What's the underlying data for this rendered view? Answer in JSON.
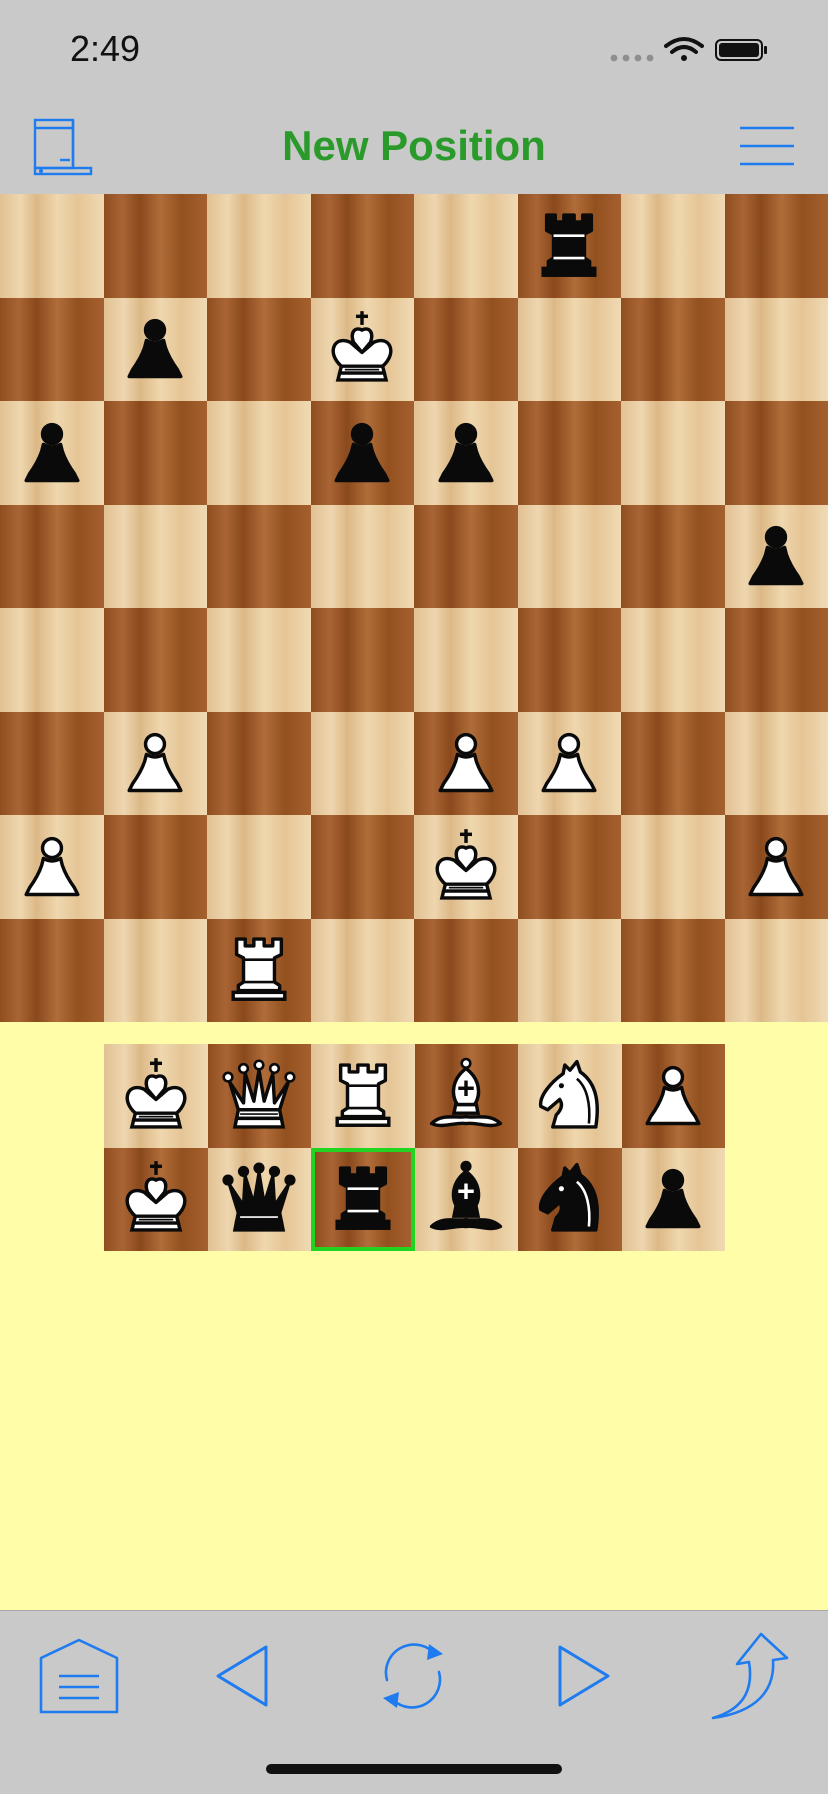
{
  "status_bar": {
    "time": "2:49"
  },
  "nav": {
    "title": "New Position",
    "title_color": "#2a9a2a"
  },
  "colors": {
    "accent": "#1e7cf0",
    "selection": "#22d322",
    "tray_bg": "#fffda8"
  },
  "board": {
    "orientation": "white-bottom",
    "pieces": [
      {
        "square": "f8",
        "piece": "black-rook"
      },
      {
        "square": "b7",
        "piece": "black-pawn"
      },
      {
        "square": "d7",
        "piece": "white-king"
      },
      {
        "square": "a6",
        "piece": "black-pawn"
      },
      {
        "square": "d6",
        "piece": "black-pawn"
      },
      {
        "square": "e6",
        "piece": "black-pawn"
      },
      {
        "square": "h5",
        "piece": "black-pawn"
      },
      {
        "square": "b3",
        "piece": "white-pawn"
      },
      {
        "square": "e3",
        "piece": "white-pawn"
      },
      {
        "square": "f3",
        "piece": "white-pawn"
      },
      {
        "square": "a2",
        "piece": "white-pawn"
      },
      {
        "square": "e2",
        "piece": "white-king"
      },
      {
        "square": "h2",
        "piece": "white-pawn"
      },
      {
        "square": "c1",
        "piece": "white-rook"
      }
    ]
  },
  "palette": {
    "white_row": [
      "white-king",
      "white-queen",
      "white-rook",
      "white-bishop",
      "white-knight",
      "white-pawn"
    ],
    "black_row": [
      "white-king",
      "black-queen",
      "black-rook",
      "black-bishop",
      "black-knight",
      "black-pawn"
    ],
    "selected": "black-rook"
  },
  "toolbar": {
    "items": [
      "home-menu-icon",
      "back-arrow-icon",
      "rotate-board-icon",
      "forward-arrow-icon",
      "share-arrow-icon"
    ]
  }
}
